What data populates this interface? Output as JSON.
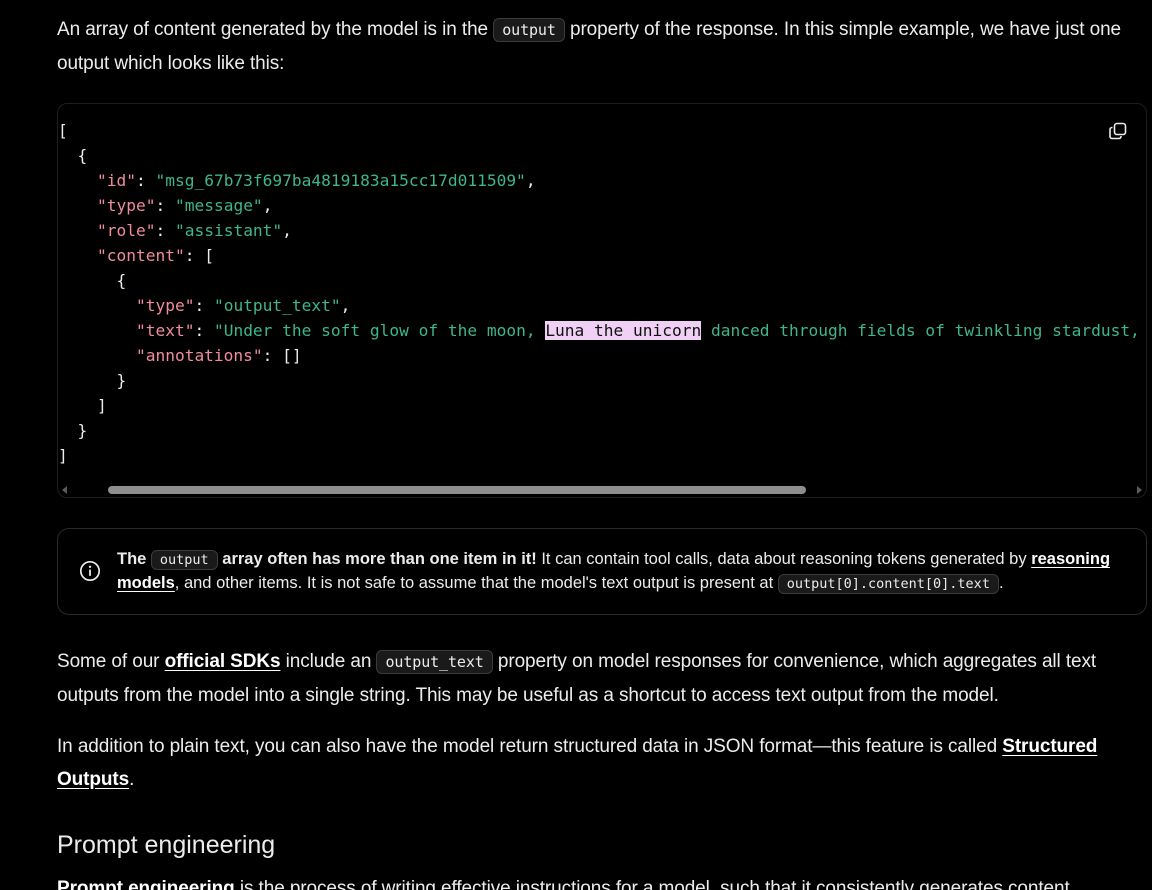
{
  "intro": {
    "text_before": "An array of content generated by the model is in the ",
    "code": "output",
    "text_after": " property of the response. In this simple example, we have just one output which looks like this:"
  },
  "code_block": {
    "lines": [
      [
        {
          "t": "p",
          "v": "["
        }
      ],
      [
        {
          "t": "p",
          "v": "  {"
        }
      ],
      [
        {
          "t": "k",
          "v": "    \"id\""
        },
        {
          "t": "p",
          "v": ": "
        },
        {
          "t": "s",
          "v": "\"msg_67b73f697ba4819183a15cc17d011509\""
        },
        {
          "t": "p",
          "v": ","
        }
      ],
      [
        {
          "t": "k",
          "v": "    \"type\""
        },
        {
          "t": "p",
          "v": ": "
        },
        {
          "t": "s",
          "v": "\"message\""
        },
        {
          "t": "p",
          "v": ","
        }
      ],
      [
        {
          "t": "k",
          "v": "    \"role\""
        },
        {
          "t": "p",
          "v": ": "
        },
        {
          "t": "s",
          "v": "\"assistant\""
        },
        {
          "t": "p",
          "v": ","
        }
      ],
      [
        {
          "t": "k",
          "v": "    \"content\""
        },
        {
          "t": "p",
          "v": ": ["
        }
      ],
      [
        {
          "t": "p",
          "v": "      {"
        }
      ],
      [
        {
          "t": "k",
          "v": "        \"type\""
        },
        {
          "t": "p",
          "v": ": "
        },
        {
          "t": "s",
          "v": "\"output_text\""
        },
        {
          "t": "p",
          "v": ","
        }
      ],
      [
        {
          "t": "k",
          "v": "        \"text\""
        },
        {
          "t": "p",
          "v": ": "
        },
        {
          "t": "s",
          "v": "\"Under the soft glow of the moon, "
        },
        {
          "t": "hl",
          "v": "Luna the unicorn"
        },
        {
          "t": "s",
          "v": " danced through fields of twinkling stardust, leav"
        }
      ],
      [
        {
          "t": "k",
          "v": "        \"annotations\""
        },
        {
          "t": "p",
          "v": ": []"
        }
      ],
      [
        {
          "t": "p",
          "v": "      }"
        }
      ],
      [
        {
          "t": "p",
          "v": "    ]"
        }
      ],
      [
        {
          "t": "p",
          "v": "  }"
        }
      ],
      [
        {
          "t": "p",
          "v": "]"
        }
      ]
    ],
    "copy_icon": "copy-icon"
  },
  "callout": {
    "icon": "info-icon",
    "bold_before": "The ",
    "bold_code": "output",
    "bold_after": " array often has more than one item in it!",
    "text1": " It can contain tool calls, data about reasoning tokens generated by ",
    "link": "reasoning models",
    "text2": ", and other items. It is not safe to assume that the model's text output is present at ",
    "code2": "output[0].content[0].text",
    "text3": "."
  },
  "para2": {
    "text1": "Some of our ",
    "link": "official SDKs",
    "text2": " include an ",
    "code": "output_text",
    "text3": " property on model responses for convenience, which aggregates all text outputs from the model into a single string. This may be useful as a shortcut to access text output from the model."
  },
  "para3": {
    "text1": "In addition to plain text, you can also have the model return structured data in JSON format—this feature is called ",
    "link": "Structured Outputs",
    "text2": "."
  },
  "heading": "Prompt engineering",
  "para4": {
    "link": "Prompt engineering",
    "text": " is the process of writing effective instructions for a model, such that it consistently generates content"
  },
  "colors": {
    "key": "#f08c9e",
    "string": "#3fb68b",
    "highlight": "#f1d0f5",
    "background": "#000000"
  }
}
